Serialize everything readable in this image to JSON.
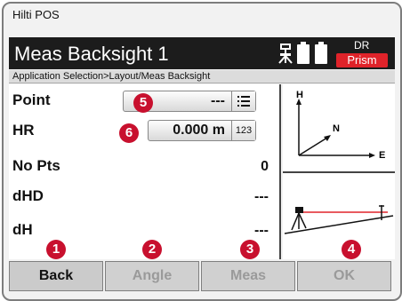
{
  "app": {
    "title": "Hilti POS"
  },
  "header": {
    "title": "Meas Backsight 1",
    "mode_top": "DR",
    "mode_bottom": "Prism"
  },
  "breadcrumb": "Application Selection>Layout/Meas Backsight",
  "fields": {
    "point": {
      "label": "Point",
      "value": "---",
      "badge": "5"
    },
    "hr": {
      "label": "HR",
      "value": "0.000 m",
      "badge": "6",
      "keypad_label": "123"
    }
  },
  "readouts": [
    {
      "label": "No Pts",
      "value": "0"
    },
    {
      "label": "dHD",
      "value": "---"
    },
    {
      "label": "dH",
      "value": "---"
    }
  ],
  "axes": {
    "h": "H",
    "n": "N",
    "e": "E"
  },
  "softkeys": [
    {
      "label": "Back",
      "badge": "1",
      "enabled": true
    },
    {
      "label": "Angle",
      "badge": "2",
      "enabled": false
    },
    {
      "label": "Meas",
      "badge": "3",
      "enabled": false
    },
    {
      "label": "OK",
      "badge": "4",
      "enabled": false
    }
  ],
  "colors": {
    "header_bg": "#1c1c1c",
    "prism_red": "#e0232a",
    "badge_red": "#c8102e"
  },
  "icons": [
    "tripod-icon",
    "battery-icon",
    "list-icon",
    "keypad-icon",
    "axes-icon",
    "sight-line-icon"
  ]
}
